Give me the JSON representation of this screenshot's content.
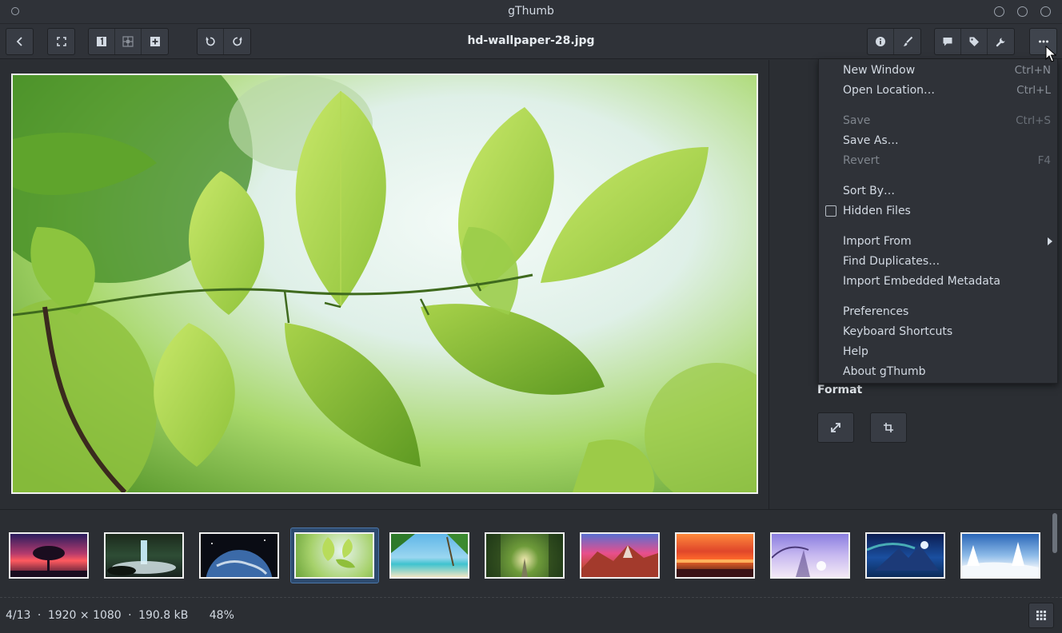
{
  "window": {
    "title": "gThumb"
  },
  "header": {
    "filename": "hd-wallpaper-28.jpg"
  },
  "toolbar": {
    "left": [
      "back-icon",
      "fullscreen-icon"
    ],
    "view_group": [
      "single-view-icon",
      "browser-view-icon",
      "add-icon"
    ],
    "rotate_group": [
      "rotate-left-icon",
      "rotate-right-icon"
    ],
    "right_group1": [
      "info-icon",
      "edit-brush-icon"
    ],
    "right_group2": [
      "comment-icon",
      "tag-icon",
      "tools-icon"
    ],
    "menu": "more-icon"
  },
  "menu": {
    "items": [
      {
        "label": "New Window",
        "accel": "Ctrl+N",
        "disabled": false
      },
      {
        "label": "Open Location…",
        "accel": "Ctrl+L",
        "disabled": false
      },
      {
        "label": "Save",
        "accel": "Ctrl+S",
        "disabled": true
      },
      {
        "label": "Save As…",
        "accel": "",
        "disabled": false
      },
      {
        "label": "Revert",
        "accel": "F4",
        "disabled": true
      },
      {
        "label": "Sort By…",
        "accel": "",
        "disabled": false
      },
      {
        "label": "Hidden Files",
        "accel": "",
        "disabled": false,
        "checkbox": true,
        "checked": false
      },
      {
        "label": "Import From",
        "accel": "",
        "disabled": false,
        "submenu": true
      },
      {
        "label": "Find Duplicates…",
        "accel": "",
        "disabled": false
      },
      {
        "label": "Import Embedded Metadata",
        "accel": "",
        "disabled": false
      },
      {
        "label": "Preferences",
        "accel": "",
        "disabled": false
      },
      {
        "label": "Keyboard Shortcuts",
        "accel": "",
        "disabled": false
      },
      {
        "label": "Help",
        "accel": "",
        "disabled": false
      },
      {
        "label": "About gThumb",
        "accel": "",
        "disabled": false
      }
    ]
  },
  "sidebar": {
    "format_label": "Format",
    "format_buttons": [
      "resize-icon",
      "crop-icon"
    ]
  },
  "thumbnails": {
    "selected_index": 3,
    "items": [
      "sunset-tree",
      "waterfall",
      "planet-earth",
      "green-leaves",
      "tropical-beach",
      "tree-tunnel",
      "desert-rocks",
      "ocean-sunset",
      "purple-winter",
      "aurora-mountains",
      "snowy-forest"
    ]
  },
  "status": {
    "position": "4/13",
    "separator": "·",
    "dimensions": "1920 × 1080",
    "size": "190.8 kB",
    "zoom": "48%",
    "full": "4/13  ·  1920 × 1080  ·  190.8 kB       48%"
  },
  "colors": {
    "accent": "#4b76a8",
    "background": "#2b2e33",
    "headerbar": "#2f3238"
  }
}
